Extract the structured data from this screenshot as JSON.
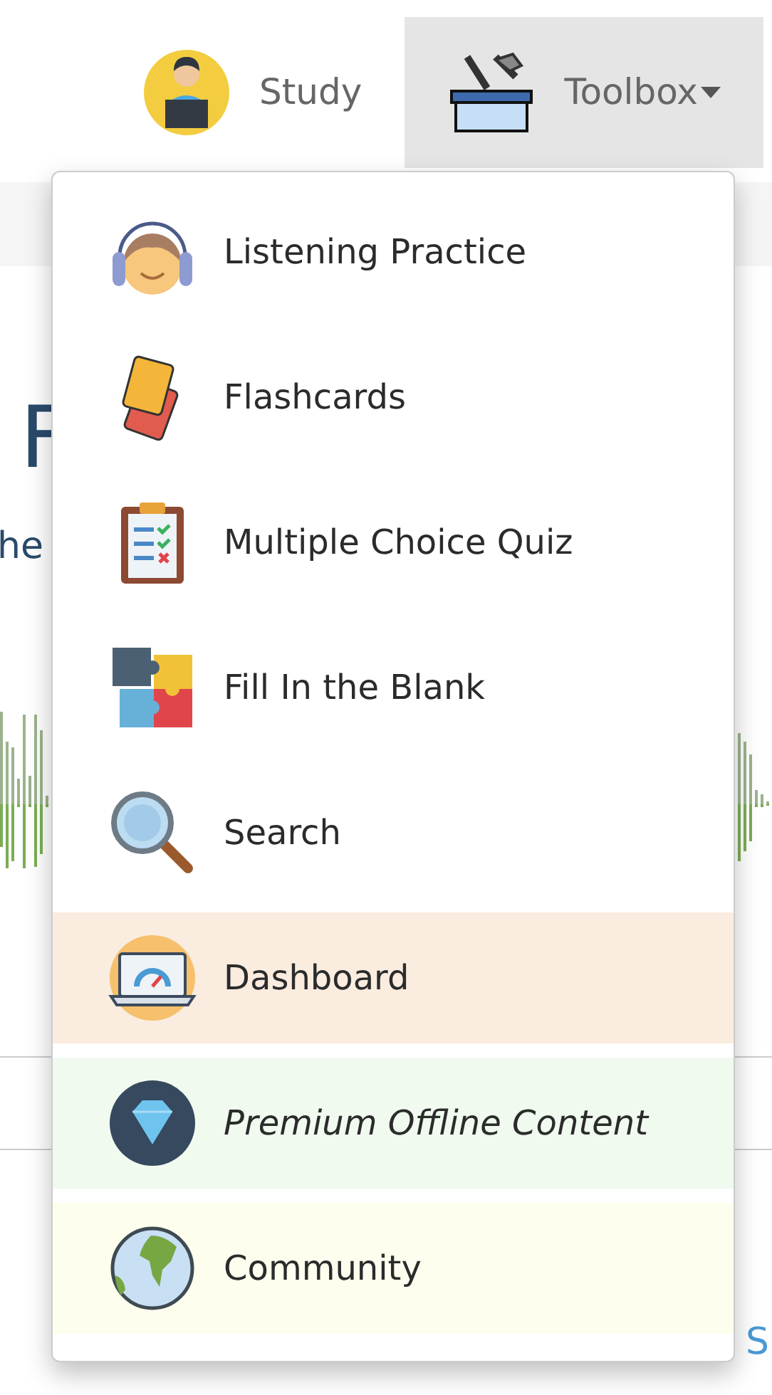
{
  "nav": [
    {
      "label": "Study",
      "kind": "link",
      "expanded": false
    },
    {
      "label": "Toolbox",
      "kind": "dropdown",
      "expanded": true
    }
  ],
  "background": {
    "heading": "F",
    "subtitle": "he",
    "corner_link": "S"
  },
  "menu": {
    "items": [
      {
        "label": "Listening Practice",
        "emphasized": false
      },
      {
        "label": "Flashcards",
        "emphasized": false
      },
      {
        "label": "Multiple Choice Quiz",
        "emphasized": false
      },
      {
        "label": "Fill In the Blank",
        "emphasized": false
      },
      {
        "label": "Search",
        "emphasized": false
      },
      {
        "label": "Dashboard",
        "emphasized": false,
        "color": "#faecdf"
      },
      {
        "label": "Premium Offline Content",
        "emphasized": true,
        "color": "#f0faef"
      },
      {
        "label": "Community",
        "emphasized": false,
        "color": "#fdfeee"
      }
    ]
  }
}
